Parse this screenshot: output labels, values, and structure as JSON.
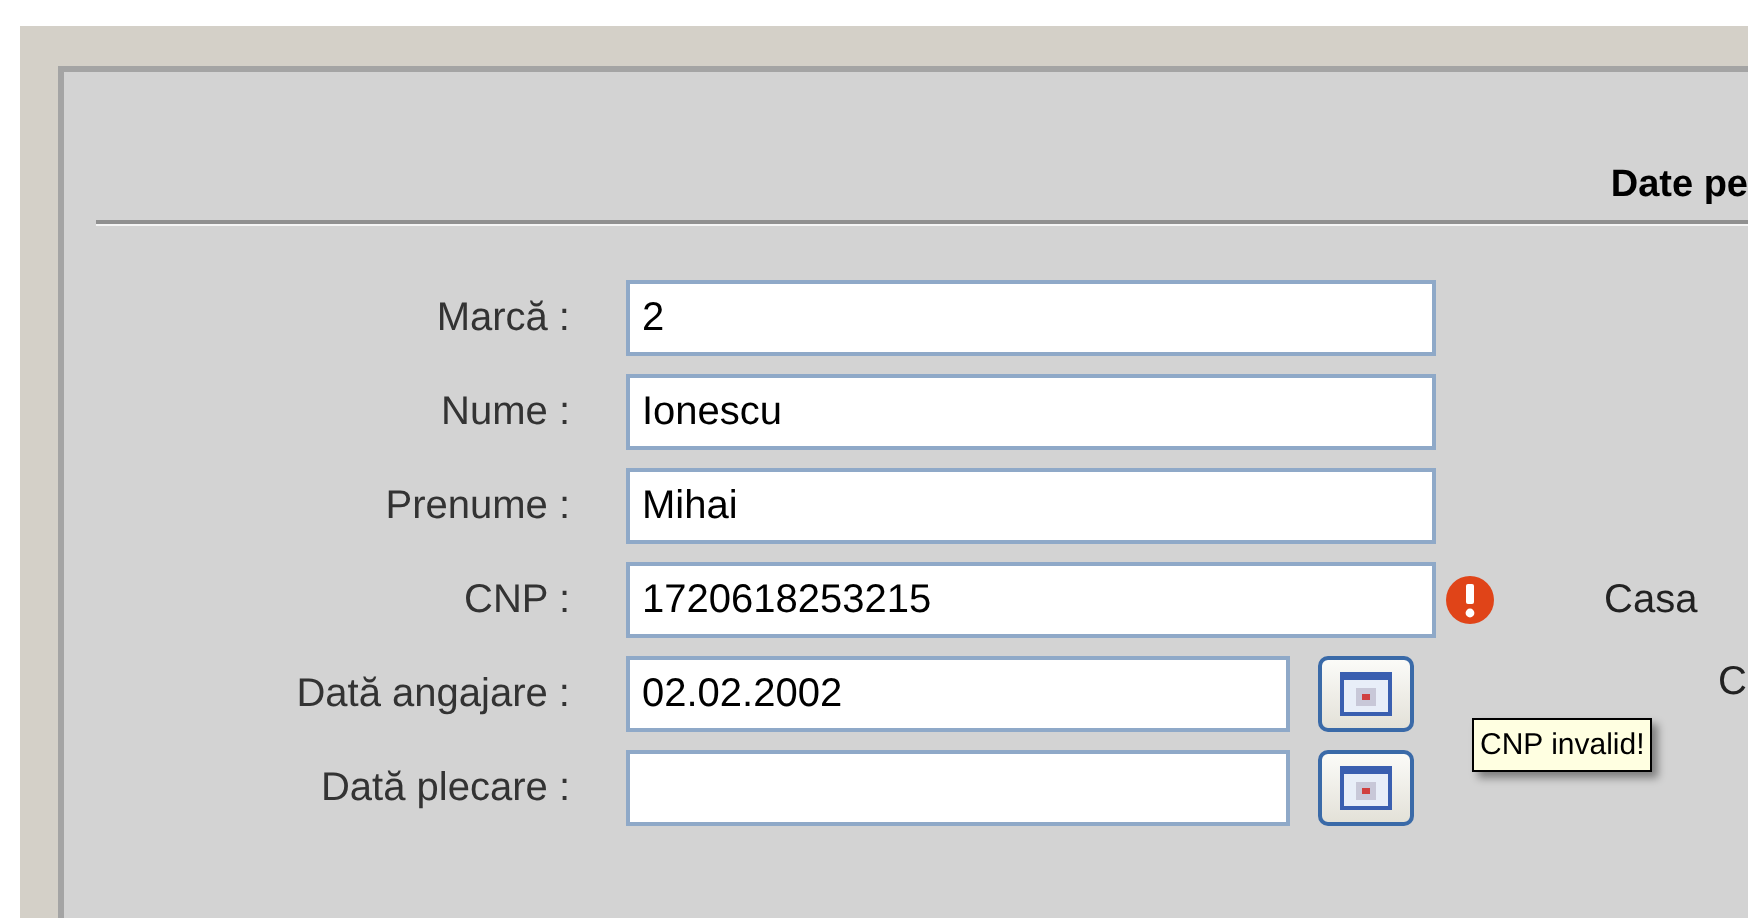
{
  "section_title": "Date pe",
  "fields": [
    {
      "label": "Marcă :",
      "value": "2",
      "kind": "text",
      "invalid": false
    },
    {
      "label": "Nume :",
      "value": "Ionescu",
      "kind": "text",
      "invalid": false
    },
    {
      "label": "Prenume :",
      "value": "Mihai",
      "kind": "text",
      "invalid": false
    },
    {
      "label": "CNP :",
      "value": "1720618253215",
      "kind": "text",
      "invalid": true,
      "side_label": "Casa"
    },
    {
      "label": "Dată angajare :",
      "value": "02.02.2002",
      "kind": "date",
      "invalid": false,
      "side_label": "C"
    },
    {
      "label": "Dată plecare :",
      "kind": "date",
      "invalid": false
    }
  ],
  "tooltip": "CNP invalid!"
}
